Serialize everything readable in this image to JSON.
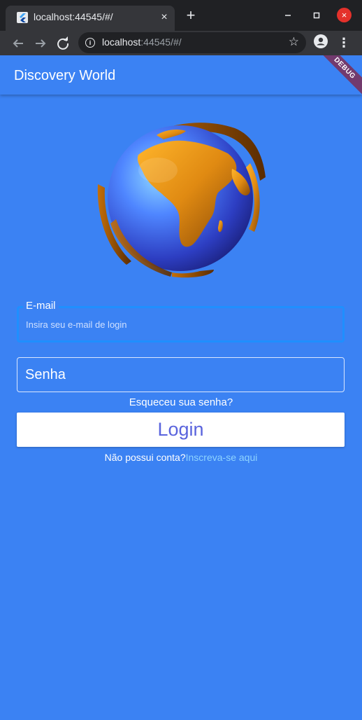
{
  "browser": {
    "tab_title": "localhost:44545/#/",
    "tab_close": "×",
    "new_tab": "+",
    "window_close": "×",
    "url_host": "localhost",
    "url_rest": ":44545/#/",
    "icons": {
      "favicon": "flutter-icon",
      "back": "back-arrow-icon",
      "forward": "forward-arrow-icon",
      "reload": "reload-icon",
      "info": "info-icon",
      "star": "star-icon",
      "profile": "profile-icon",
      "menu": "menu-dots-icon"
    }
  },
  "app": {
    "title": "Discovery World",
    "debug_banner": "DEBUG",
    "email": {
      "label": "E-mail",
      "placeholder": "Insira seu e-mail de login"
    },
    "password": {
      "label": "Senha"
    },
    "forgot_password": "Esqueceu sua senha?",
    "login_button": "Login",
    "signup_question": "Não possui conta?",
    "signup_link": "Inscreva-se aqui",
    "colors": {
      "background": "#3b82f3",
      "focus_border": "#1f8fff",
      "login_text": "#5a64dd",
      "link": "#8ed4ff"
    }
  }
}
